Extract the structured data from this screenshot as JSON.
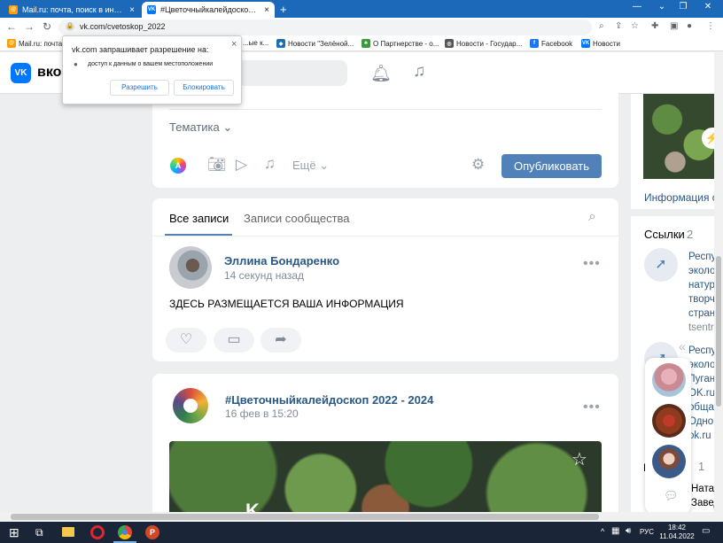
{
  "browser": {
    "tabs": [
      {
        "title": "Mail.ru: почта, поиск в интерне",
        "icon": "mailru-icon"
      },
      {
        "title": "#Цветочныйкалейдоскоп 2022",
        "icon": "vk-icon"
      }
    ],
    "new_tab": "+",
    "url": "vk.com/cvetoskop_2022",
    "bookmarks": [
      {
        "label": "Mail.ru: почта"
      },
      {
        "label": "...ые к..."
      },
      {
        "label": "Новости \"Зелёной..."
      },
      {
        "label": "О Партнерстве - о..."
      },
      {
        "label": "Новости - Государ..."
      },
      {
        "label": "Facebook"
      },
      {
        "label": "Новости"
      }
    ]
  },
  "permission": {
    "title": "vk.com запрашивает разрешение на:",
    "item": "доступ к данным о вашем местоположении",
    "allow": "Разрешить",
    "block": "Блокировать",
    "close": "×"
  },
  "vk": {
    "logo": "VK",
    "name": "вко"
  },
  "composer": {
    "topic": "Тематика",
    "more": "Ещё",
    "publish": "Опубликовать"
  },
  "feed_tabs": {
    "all": "Все записи",
    "community": "Записи сообщества"
  },
  "post1": {
    "author": "Эллина Бондаренко",
    "time": "14 секунд назад",
    "text": "ЗДЕСЬ РАЗМЕЩАЕТСЯ ВАША ИНФОРМАЦИЯ"
  },
  "post2": {
    "author": "#Цветочныйкалейдоскоп 2022 - 2024",
    "time": "16 фев в 15:20",
    "overlay_text": "K..."
  },
  "sidebar": {
    "info": "Информация о",
    "links_title": "Ссылки",
    "links_count": "2",
    "link1_lines": [
      "Респу",
      "эколо",
      "натур",
      "творч",
      "стран"
    ],
    "link1_domain": "tsentr",
    "link2_lines": [
      "Респу",
      "эколо",
      "Луган",
      "OK.ru",
      "общаl",
      "Одно",
      "ok.ru"
    ],
    "count_1": "1",
    "bottom_lines": [
      "Ната.",
      "Завед"
    ],
    "badge": "«"
  },
  "taskbar": {
    "lang": "РУС",
    "time": "18:42",
    "date": "11.04.2022"
  },
  "colors": {
    "accent": "#2a5885",
    "vk_blue": "#0077ff",
    "publish_btn": "#5181b8",
    "browser_tab_bar": "#1d69b9"
  }
}
